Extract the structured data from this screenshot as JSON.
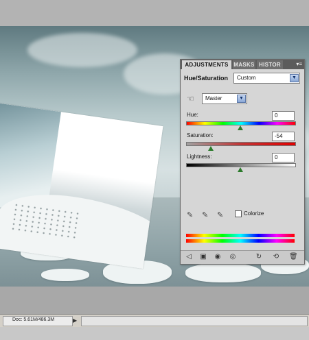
{
  "panel": {
    "tabs": [
      {
        "label": "ADJUSTMENTS"
      },
      {
        "label": "MASKS"
      },
      {
        "label": "HISTOR"
      }
    ],
    "menu_icon": "panel-menu-icon",
    "title": "Hue/Saturation",
    "preset_value": "Custom",
    "channel_value": "Master",
    "hue": {
      "label": "Hue:",
      "value": "0"
    },
    "saturation": {
      "label": "Saturation:",
      "value": "-54"
    },
    "lightness": {
      "label": "Lightness:",
      "value": "0"
    },
    "colorize_label": "Colorize",
    "colorize_checked": false,
    "footer_icons": [
      "back-arrow-icon",
      "layer-view-icon",
      "clip-icon",
      "eye-icon",
      "previous-state-icon",
      "reset-icon",
      "trash-icon"
    ]
  },
  "status": {
    "doc_text": "Doc: 5.61M/486.3M",
    "arrow": "▶"
  }
}
